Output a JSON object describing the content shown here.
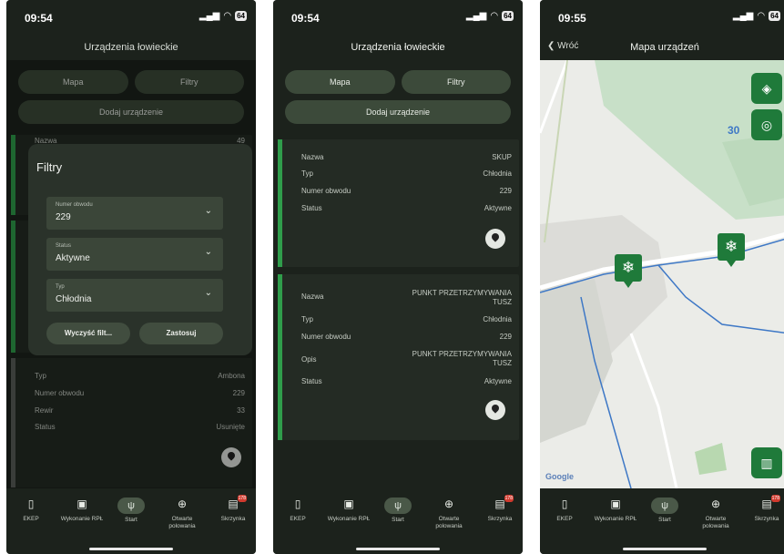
{
  "phone1": {
    "time": "09:54",
    "battery": "64",
    "title": "Urządzenia łowieckie",
    "mapa": "Mapa",
    "filtry": "Filtry",
    "dodaj": "Dodaj urządzenie",
    "bg_card_top": "Nazwa",
    "bg_card_top_val": "49",
    "bg_rows": [
      {
        "label": "Typ",
        "value": "Ambona"
      },
      {
        "label": "Numer obwodu",
        "value": "229"
      },
      {
        "label": "Rewir",
        "value": "33"
      },
      {
        "label": "Status",
        "value": "Usunięte"
      }
    ],
    "filters": {
      "title": "Filtry",
      "f1_label": "Numer obwodu",
      "f1_value": "229",
      "f2_label": "Status",
      "f2_value": "Aktywne",
      "f3_label": "Typ",
      "f3_value": "Chłodnia",
      "clear": "Wyczyść filt...",
      "apply": "Zastosuj"
    }
  },
  "phone2": {
    "time": "09:54",
    "battery": "64",
    "title": "Urządzenia łowieckie",
    "mapa": "Mapa",
    "filtry": "Filtry",
    "dodaj": "Dodaj urządzenie",
    "card1": [
      {
        "label": "Nazwa",
        "value": "SKUP"
      },
      {
        "label": "Typ",
        "value": "Chłodnia"
      },
      {
        "label": "Numer obwodu",
        "value": "229"
      },
      {
        "label": "Status",
        "value": "Aktywne"
      }
    ],
    "card2": {
      "nazwa_l": "Nazwa",
      "nazwa_v1": "PUNKT PRZETRZYMYWANIA",
      "nazwa_v2": "TUSZ",
      "typ_l": "Typ",
      "typ_v": "Chłodnia",
      "nr_l": "Numer obwodu",
      "nr_v": "229",
      "opis_l": "Opis",
      "opis_v1": "PUNKT PRZETRZYMYWANIA",
      "opis_v2": "TUSZ",
      "status_l": "Status",
      "status_v": "Aktywne"
    }
  },
  "phone3": {
    "time": "09:55",
    "battery": "64",
    "back": "Wróć",
    "title": "Mapa urządzeń",
    "map_number": "30",
    "google": "Google"
  },
  "tabs": [
    {
      "label": "EKEP",
      "icon": "book-icon"
    },
    {
      "label": "Wykonanie RPŁ",
      "icon": "calendar-icon"
    },
    {
      "label": "Start",
      "icon": "deer-icon"
    },
    {
      "label": "Otwarte polowania",
      "icon": "target-icon"
    },
    {
      "label": "Skrzynka",
      "icon": "inbox-icon",
      "badge": "178"
    }
  ],
  "colors": {
    "accent": "#2f9d4b",
    "marker": "#1f7a3a",
    "background": "#1c221c"
  }
}
